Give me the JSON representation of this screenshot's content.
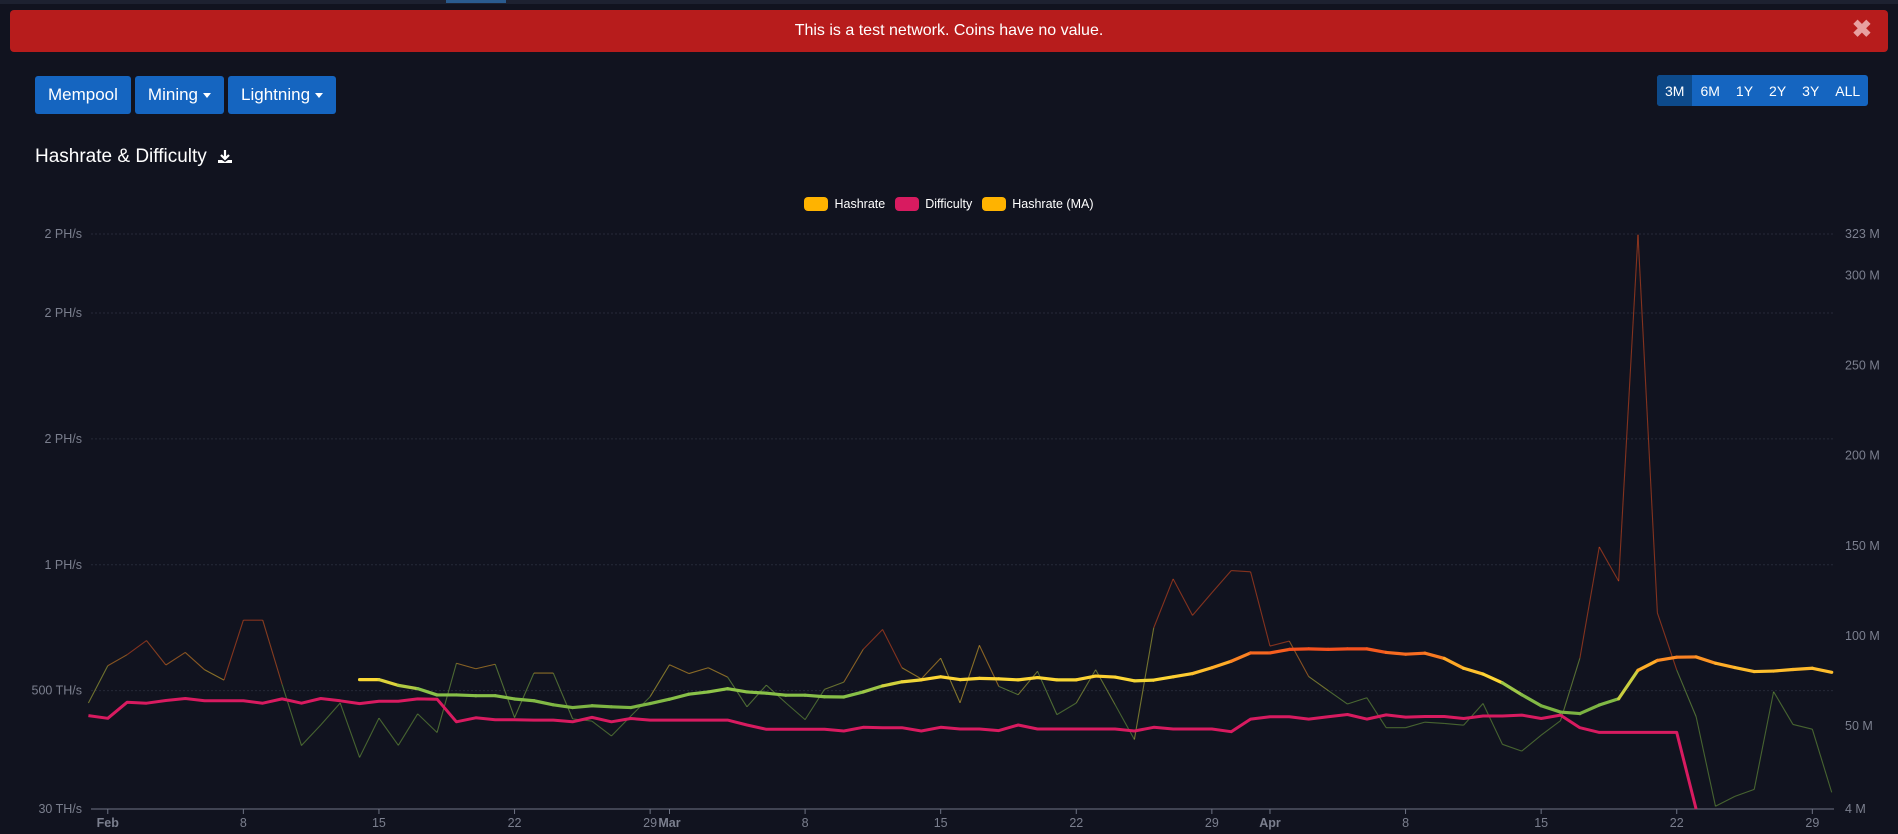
{
  "alert": {
    "text": "This is a test network. Coins have no value.",
    "close_icon": "close-icon"
  },
  "nav": {
    "mempool": "Mempool",
    "mining": "Mining",
    "lightning": "Lightning"
  },
  "time_ranges": [
    {
      "label": "3M",
      "active": true
    },
    {
      "label": "6M",
      "active": false
    },
    {
      "label": "1Y",
      "active": false
    },
    {
      "label": "2Y",
      "active": false
    },
    {
      "label": "3Y",
      "active": false
    },
    {
      "label": "ALL",
      "active": false
    }
  ],
  "title": "Hashrate & Difficulty",
  "colors": {
    "alert": "#b71c1c",
    "button": "#1565c0",
    "button_active": "#0d4a8a",
    "background": "#11131f"
  },
  "chart_data": {
    "type": "line",
    "legend": [
      {
        "name": "Hashrate",
        "color": "#ffb300"
      },
      {
        "name": "Difficulty",
        "color": "#d81b60"
      },
      {
        "name": "Hashrate (MA)",
        "color": "#ffb300"
      }
    ],
    "legend_position": "top-center",
    "grid": true,
    "x": [
      "Jan 31",
      "Feb 1",
      "Feb 2",
      "Feb 3",
      "Feb 4",
      "Feb 5",
      "Feb 6",
      "Feb 7",
      "Feb 8",
      "Feb 9",
      "Feb 10",
      "Feb 11",
      "Feb 12",
      "Feb 13",
      "Feb 14",
      "Feb 15",
      "Feb 16",
      "Feb 17",
      "Feb 18",
      "Feb 19",
      "Feb 20",
      "Feb 21",
      "Feb 22",
      "Feb 23",
      "Feb 24",
      "Feb 25",
      "Feb 26",
      "Feb 27",
      "Feb 28",
      "Feb 29",
      "Mar 1",
      "Mar 2",
      "Mar 3",
      "Mar 4",
      "Mar 5",
      "Mar 6",
      "Mar 7",
      "Mar 8",
      "Mar 9",
      "Mar 10",
      "Mar 11",
      "Mar 12",
      "Mar 13",
      "Mar 14",
      "Mar 15",
      "Mar 16",
      "Mar 17",
      "Mar 18",
      "Mar 19",
      "Mar 20",
      "Mar 21",
      "Mar 22",
      "Mar 23",
      "Mar 24",
      "Mar 25",
      "Mar 26",
      "Mar 27",
      "Mar 28",
      "Mar 29",
      "Mar 30",
      "Mar 31",
      "Apr 1",
      "Apr 2",
      "Apr 3",
      "Apr 4",
      "Apr 5",
      "Apr 6",
      "Apr 7",
      "Apr 8",
      "Apr 9",
      "Apr 10",
      "Apr 11",
      "Apr 12",
      "Apr 13",
      "Apr 14",
      "Apr 15",
      "Apr 16",
      "Apr 17",
      "Apr 18",
      "Apr 19",
      "Apr 20",
      "Apr 21",
      "Apr 22",
      "Apr 23",
      "Apr 24",
      "Apr 25",
      "Apr 26",
      "Apr 27",
      "Apr 28",
      "Apr 29",
      "Apr 30"
    ],
    "x_ticks": [
      {
        "label": "Feb",
        "date": "Feb 1",
        "bold": true
      },
      {
        "label": "8",
        "date": "Feb 8"
      },
      {
        "label": "15",
        "date": "Feb 15"
      },
      {
        "label": "22",
        "date": "Feb 22"
      },
      {
        "label": "29",
        "date": "Feb 29"
      },
      {
        "label": "Mar",
        "date": "Mar 1",
        "bold": true
      },
      {
        "label": "8",
        "date": "Mar 8"
      },
      {
        "label": "15",
        "date": "Mar 15"
      },
      {
        "label": "22",
        "date": "Mar 22"
      },
      {
        "label": "29",
        "date": "Mar 29"
      },
      {
        "label": "Apr",
        "date": "Apr 1",
        "bold": true
      },
      {
        "label": "8",
        "date": "Apr 8"
      },
      {
        "label": "15",
        "date": "Apr 15"
      },
      {
        "label": "22",
        "date": "Apr 22"
      },
      {
        "label": "29",
        "date": "Apr 29"
      }
    ],
    "y_left": {
      "unit": "TH/s",
      "ylim": [
        30,
        2314
      ],
      "ticks": [
        {
          "value": 30,
          "label": "30 TH/s"
        },
        {
          "value": 500,
          "label": "500 TH/s"
        },
        {
          "value": 1000,
          "label": "1 PH/s"
        },
        {
          "value": 1500,
          "label": "2 PH/s"
        },
        {
          "value": 2000,
          "label": "2 PH/s"
        },
        {
          "value": 2314,
          "label": "2 PH/s"
        }
      ]
    },
    "y_right": {
      "unit": "M",
      "ylim": [
        4,
        323
      ],
      "ticks": [
        {
          "value": 4,
          "label": "4 M"
        },
        {
          "value": 50,
          "label": "50 M"
        },
        {
          "value": 100,
          "label": "100 M"
        },
        {
          "value": 150,
          "label": "150 M"
        },
        {
          "value": 200,
          "label": "200 M"
        },
        {
          "value": 250,
          "label": "250 M"
        },
        {
          "value": 300,
          "label": "300 M"
        },
        {
          "value": 323,
          "label": "323 M"
        }
      ]
    },
    "visual_map": [
      {
        "value": 430,
        "color": "#7cb342"
      },
      {
        "value": 500,
        "color": "#8bc34a"
      },
      {
        "value": 545,
        "color": "#fdd835"
      },
      {
        "value": 610,
        "color": "#ffa726"
      },
      {
        "value": 665,
        "color": "#f4511e"
      }
    ],
    "series": [
      {
        "name": "Hashrate",
        "axis": "left",
        "values": [
          451,
          599,
          643,
          699,
          602,
          652,
          583,
          542,
          780,
          780,
          525,
          282,
          364,
          451,
          235,
          391,
          283,
          408,
          334,
          609,
          587,
          605,
          393,
          570,
          570,
          388,
          379,
          320,
          399,
          476,
          603,
          568,
          591,
          554,
          436,
          522,
          452,
          385,
          505,
          534,
          664,
          743,
          591,
          547,
          629,
          452,
          680,
          517,
          484,
          577,
          405,
          451,
          583,
          445,
          306,
          750,
          944,
          799,
          889,
          977,
          972,
          677,
          697,
          556,
          501,
          447,
          472,
          353,
          353,
          375,
          370,
          363,
          449,
          287,
          260,
          323,
          381,
          629,
          1071,
          935,
          2311,
          809,
          582,
          397,
          41,
          80,
          108,
          496,
          366,
          347,
          96
        ]
      },
      {
        "name": "Difficulty",
        "axis": "right",
        "values": [
          55.8,
          54.3,
          63.2,
          62.7,
          64.2,
          65.3,
          64,
          64,
          64,
          62.7,
          65.1,
          62.7,
          65.3,
          64,
          62.5,
          63.8,
          63.8,
          65.1,
          64.9,
          52.4,
          54.6,
          53.5,
          53.5,
          53.3,
          53.3,
          52.4,
          54.8,
          52.4,
          54.2,
          53.3,
          53.3,
          53.3,
          53.3,
          53.3,
          50.6,
          48.2,
          48.2,
          48.2,
          48.2,
          47.3,
          49.3,
          49.1,
          49.1,
          47.3,
          49.3,
          48.4,
          48.4,
          47.5,
          50.6,
          48.4,
          48.4,
          48.4,
          48.4,
          48.4,
          47.3,
          49.3,
          48.4,
          48.4,
          48.4,
          46.9,
          53.9,
          55.2,
          55.2,
          53.9,
          55.2,
          56.4,
          53.9,
          56.2,
          55,
          55.3,
          55.3,
          54.2,
          55.6,
          55.6,
          56.1,
          54.2,
          56.1,
          49.1,
          46.5,
          46.5,
          46.5,
          46.5,
          46.5,
          4,
          null,
          null,
          null,
          null,
          null,
          null,
          null
        ]
      },
      {
        "name": "Hashrate (MA)",
        "axis": "left",
        "values": [
          null,
          null,
          null,
          null,
          null,
          null,
          null,
          null,
          null,
          null,
          null,
          null,
          null,
          null,
          544,
          544,
          521,
          508,
          483,
          483,
          480,
          480,
          467,
          460,
          444,
          433,
          440,
          436,
          433,
          449,
          466,
          486,
          495,
          508,
          495,
          490,
          482,
          482,
          476,
          475,
          495,
          519,
          535,
          543,
          555,
          544,
          549,
          547,
          543,
          552,
          543,
          543,
          558,
          554,
          539,
          542,
          555,
          568,
          591,
          617,
          650,
          650,
          664,
          666,
          664,
          666,
          666,
          652,
          645,
          649,
          628,
          589,
          566,
          531,
          484,
          440,
          415,
          409,
          443,
          468,
          581,
          620,
          633,
          634,
          609,
          592,
          576,
          578,
          584,
          589,
          573
        ]
      }
    ]
  }
}
